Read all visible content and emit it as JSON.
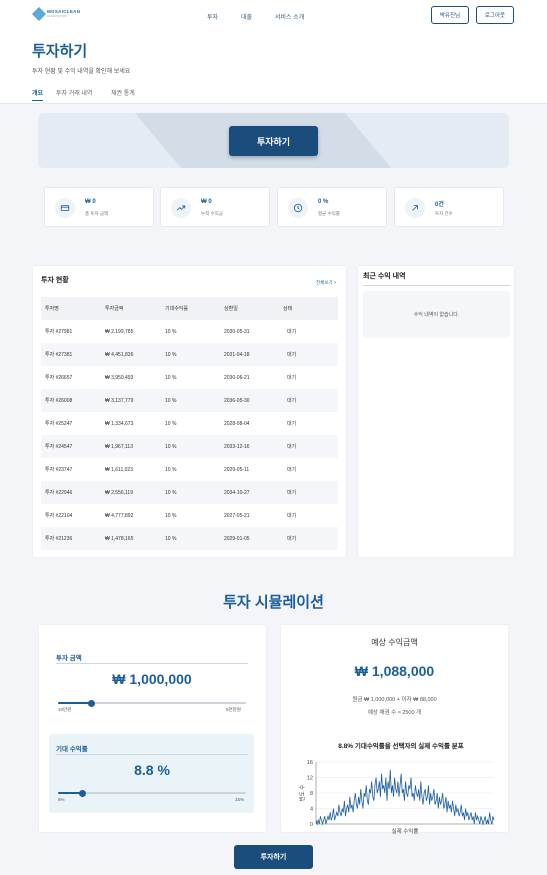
{
  "header": {
    "logo_name": "MOSAICLEAN",
    "logo_sub": "HONEYWORK",
    "nav": [
      "투자",
      "대출",
      "서비스 소개"
    ],
    "user_button": "박유진님",
    "logout_button": "로그아웃"
  },
  "page": {
    "title": "투자하기",
    "subtitle": "투자 현황 및 수익 내역을 확인해 보세요",
    "tabs": [
      "개요",
      "투자 거래 내역",
      "채권 통계"
    ],
    "active_tab": 0
  },
  "banner": {
    "button": "투자하기"
  },
  "stats": [
    {
      "icon": "card-icon",
      "value": "₩ 0",
      "label": "총 투자 금액"
    },
    {
      "icon": "trending-up-icon",
      "value": "₩ 0",
      "label": "누적 수익금"
    },
    {
      "icon": "clock-icon",
      "value": "0 %",
      "label": "평균 수익률"
    },
    {
      "icon": "arrow-up-right-icon",
      "value": "0건",
      "label": "투자 건수"
    }
  ],
  "investment_status": {
    "title": "투자 현황",
    "view_all": "전체보기 >",
    "columns": [
      "투자명",
      "투자금액",
      "기대수익률",
      "상환일",
      "상태"
    ],
    "rows": [
      [
        "투자 #27981",
        "₩ 2,199,785",
        "10 %",
        "2030-05-31",
        "대기"
      ],
      [
        "투자 #27381",
        "₩ 4,451,826",
        "10 %",
        "2031-04-18",
        "대기"
      ],
      [
        "투자 #26657",
        "₩ 3,950,493",
        "10 %",
        "2030-06-21",
        "대기"
      ],
      [
        "투자 #26008",
        "₩ 3,137,779",
        "10 %",
        "2036-05-30",
        "대기"
      ],
      [
        "투자 #25247",
        "₩ 1,334,673",
        "10 %",
        "2028-08-04",
        "대기"
      ],
      [
        "투자 #24547",
        "₩ 1,967,113",
        "10 %",
        "2033-12-16",
        "대기"
      ],
      [
        "투자 #23747",
        "₩ 1,611,023",
        "10 %",
        "2029-05-11",
        "대기"
      ],
      [
        "투자 #22946",
        "₩ 2,556,119",
        "10 %",
        "2034-10-27",
        "대기"
      ],
      [
        "투자 #22104",
        "₩ 4,777,892",
        "10 %",
        "2027-05-21",
        "대기"
      ],
      [
        "투자 #21236",
        "₩ 1,478,165",
        "10 %",
        "2029-01-05",
        "대기"
      ]
    ]
  },
  "recent_income": {
    "title": "최근 수익 내역",
    "empty_text": "수익 내역이 없습니다."
  },
  "simulation": {
    "title": "투자 시뮬레이션",
    "amount": {
      "label": "투자 금액",
      "value": "₩ 1,000,000",
      "min_label": "10만원",
      "max_label": "5천만원",
      "slider_fraction": 0.18
    },
    "rate": {
      "label": "기대 수익률",
      "value": "8.8 %",
      "min_label": "6%",
      "max_label": "15%",
      "slider_fraction": 0.13
    },
    "result": {
      "label": "예상 수익금액",
      "value": "₩ 1,088,000",
      "detail": "원금 ₩ 1,000,000 + 이자 ₩ 88,000",
      "bond_count": "예상 채권 수 ≈ 2500 개"
    },
    "button": "투자하기"
  },
  "chart_data": {
    "type": "line",
    "title": "8.8% 기대수익률을 선택자의 실제 수익률 분포",
    "xlabel": "실제 수익률",
    "ylabel": "빈도 수",
    "ylim": [
      0,
      16
    ],
    "yticks": [
      0,
      4,
      8,
      12,
      16
    ],
    "grid": true,
    "color": "#1f5fa0",
    "values": [
      1,
      0,
      1,
      0,
      2,
      1,
      0,
      1,
      2,
      0,
      1,
      2,
      1,
      3,
      1,
      2,
      4,
      1,
      2,
      3,
      2,
      5,
      3,
      2,
      4,
      3,
      6,
      2,
      4,
      5,
      3,
      7,
      4,
      5,
      3,
      6,
      8,
      5,
      4,
      7,
      5,
      9,
      6,
      4,
      8,
      7,
      10,
      6,
      5,
      9,
      8,
      11,
      7,
      6,
      10,
      12,
      8,
      9,
      11,
      7,
      13,
      9,
      10,
      8,
      12,
      6,
      11,
      9,
      14,
      8,
      10,
      7,
      12,
      9,
      8,
      11,
      7,
      10,
      13,
      8,
      9,
      6,
      11,
      8,
      7,
      10,
      9,
      12,
      7,
      8,
      6,
      10,
      8,
      7,
      9,
      6,
      11,
      7,
      5,
      8,
      9,
      6,
      7,
      10,
      5,
      8,
      6,
      7,
      9,
      5,
      6,
      8,
      4,
      7,
      5,
      6,
      8,
      4,
      5,
      7,
      3,
      6,
      4,
      5,
      3,
      6,
      4,
      2,
      5,
      3,
      4,
      2,
      3,
      5,
      2,
      3,
      1,
      4,
      2,
      3,
      1,
      2,
      3,
      1,
      2,
      0,
      3,
      1,
      2,
      1,
      0,
      2,
      1,
      0,
      1,
      2,
      0,
      1,
      0,
      3,
      1,
      0,
      2,
      1
    ]
  }
}
